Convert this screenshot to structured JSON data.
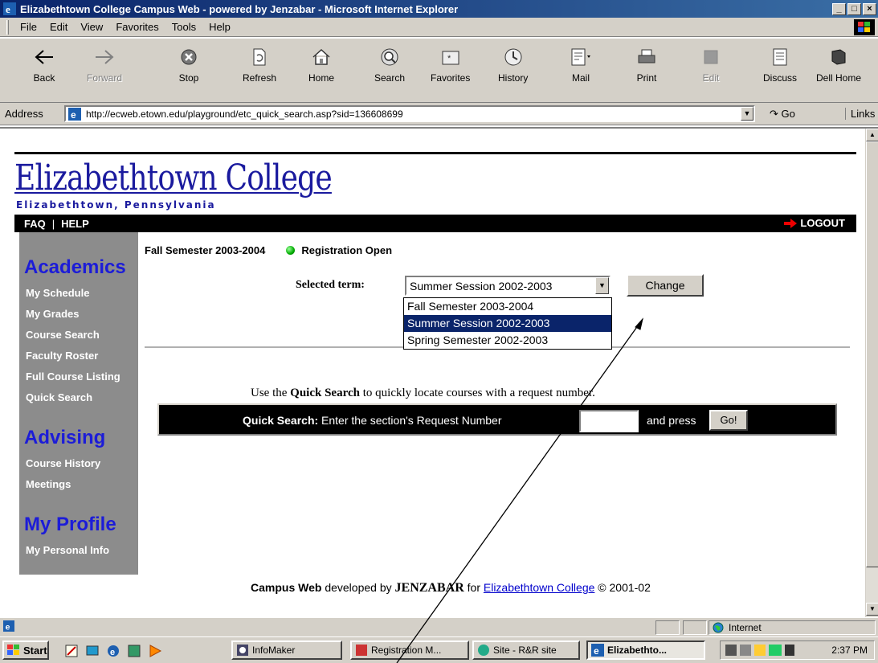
{
  "window": {
    "title": "Elizabethtown College Campus Web - powered by Jenzabar - Microsoft Internet Explorer",
    "min": "_",
    "max": "□",
    "close": "×"
  },
  "menu": [
    "File",
    "Edit",
    "View",
    "Favorites",
    "Tools",
    "Help"
  ],
  "toolbar": {
    "back": "Back",
    "forward": "Forward",
    "stop": "Stop",
    "refresh": "Refresh",
    "home": "Home",
    "search": "Search",
    "favorites": "Favorites",
    "history": "History",
    "mail": "Mail",
    "print": "Print",
    "edit": "Edit",
    "discuss": "Discuss",
    "dellhome": "Dell Home"
  },
  "address": {
    "label": "Address",
    "url": "http://ecweb.etown.edu/playground/etc_quick_search.asp?sid=136608699",
    "go": "Go",
    "links": "Links"
  },
  "page": {
    "logo_title": "Elizabethtown College",
    "logo_sub": "Elizabethtown, Pennsylvania",
    "nav": {
      "faq": "FAQ",
      "sep": "|",
      "help": "HELP",
      "logout": "LOGOUT"
    },
    "sidebar": {
      "academics": "Academics",
      "academics_links": [
        "My Schedule",
        "My Grades",
        "Course Search",
        "Faculty Roster",
        "Full Course Listing",
        "Quick Search"
      ],
      "advising": "Advising",
      "advising_links": [
        "Course History",
        "Meetings"
      ],
      "profile": "My Profile",
      "profile_links": [
        "My Personal Info"
      ]
    },
    "term_status": {
      "term": "Fall Semester 2003-2004",
      "status": "Registration Open"
    },
    "term_select": {
      "label": "Selected term:",
      "selected": "Summer Session 2002-2003",
      "options": [
        "Fall Semester 2003-2004",
        "Summer Session 2002-2003",
        "Spring Semester 2002-2003"
      ],
      "change": "Change"
    },
    "quick_search": {
      "hint_pre": "Use the ",
      "hint_bold": "Quick Search",
      "hint_post": " to quickly locate courses with a request number.",
      "bar_bold": "Quick Search:",
      "bar_text": " Enter the section's Request Number",
      "press": "and press",
      "go": "Go!"
    },
    "footer": {
      "campus_web": "Campus Web",
      "developed_by": " developed by ",
      "jenzabar": "JENZABAR",
      "for": " for ",
      "college_link": "Elizabethtown College",
      "copyright": " © 2001-02"
    }
  },
  "status": {
    "zone": "Internet"
  },
  "taskbar": {
    "start": "Start",
    "tasks": [
      "InfoMaker",
      "Registration M...",
      "Site - R&R site",
      "Elizabethto..."
    ],
    "clock": "2:37 PM"
  },
  "colors": {
    "sidebar_heading": "#1c1cd8",
    "titlebar": "#0a246a",
    "selection": "#0a246a",
    "sidebar_bg": "#8c8c8c"
  }
}
